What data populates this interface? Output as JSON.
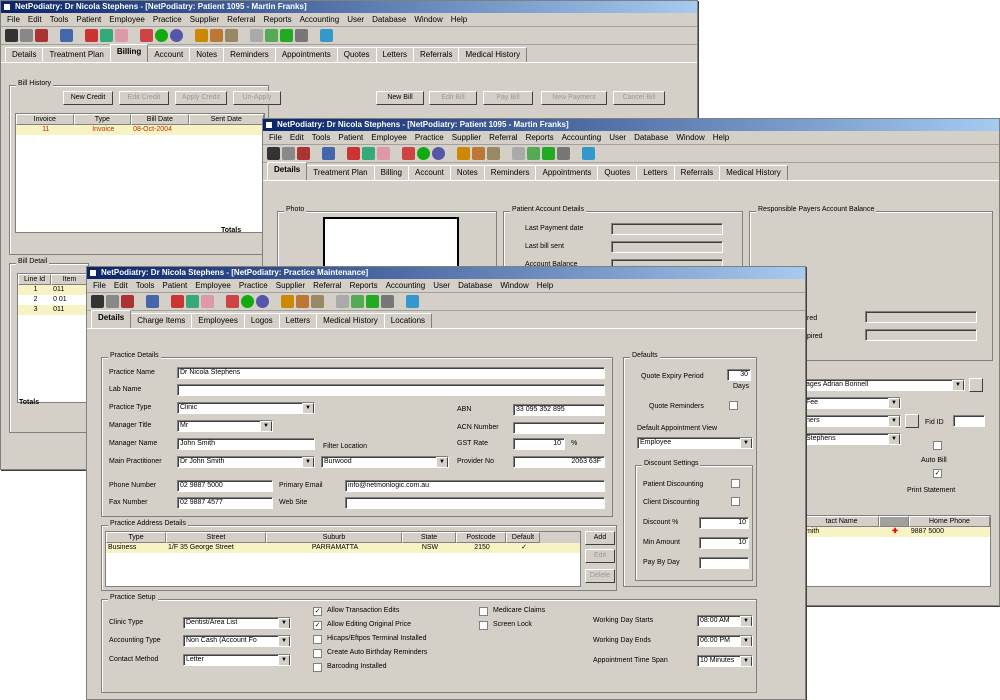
{
  "menu": [
    "File",
    "Edit",
    "Tools",
    "Patient",
    "Employee",
    "Practice",
    "Supplier",
    "Referral",
    "Reports",
    "Accounting",
    "User",
    "Database",
    "Window",
    "Help"
  ],
  "back": {
    "title": "NetPodiatry: Dr Nicola Stephens - [NetPodiatry: Patient 1095 - Martin Franks]",
    "tabs": [
      "Details",
      "Treatment Plan",
      "Billing",
      "Account",
      "Notes",
      "Reminders",
      "Appointments",
      "Quotes",
      "Letters",
      "Referrals",
      "Medical History"
    ],
    "bill_history_label": "Bill History",
    "buttons": [
      "New Credit",
      "Edit Credit",
      "Apply Credit",
      "Un-Apply",
      "New Bill",
      "Edit Bill",
      "Pay Bill",
      "New Payment",
      "Cancel Bill"
    ],
    "columns": [
      "Invoice",
      "Type",
      "Bill Date",
      "Sent Date"
    ],
    "row": [
      "11",
      "Invoice",
      "08-Oct-2004",
      ""
    ],
    "totals_label": "Totals",
    "bill_detail_label": "Bill Detail",
    "detail_columns": [
      "Line Id",
      "Item"
    ],
    "detail_rows": [
      [
        "1",
        "011"
      ],
      [
        "2",
        "0 01"
      ],
      [
        "3",
        "011"
      ]
    ],
    "detail_totals": "Totals"
  },
  "mid": {
    "title": "NetPodiatry: Dr Nicola Stephens - [NetPodiatry: Patient 1095 - Martin Franks]",
    "tabs": [
      "Details",
      "Treatment Plan",
      "Billing",
      "Account",
      "Notes",
      "Reminders",
      "Appointments",
      "Quotes",
      "Letters",
      "Referrals",
      "Medical History"
    ],
    "photo_label": "Photo",
    "pad_label": "Patient Account Details",
    "last_payment": "Last Payment date",
    "last_bill": "Last bill sent",
    "account_balance": "Account Balance",
    "rp_label": "Responsible Payers Account Balance",
    "lbl_red": "red",
    "lbl_pired": "pired",
    "dd1": "ages Adrian Bonnell",
    "dd2": "Fee",
    "dd3": "ners",
    "dd4": "Stephens",
    "fid_label": "Fid ID",
    "auto_bill": "Auto Bill",
    "print_statement": "Print Statement",
    "grid_cols": [
      "tact Name",
      "",
      "Home Phone"
    ],
    "grid_row": [
      "mith",
      "",
      "9887 5000"
    ]
  },
  "front": {
    "title": "NetPodiatry: Dr Nicola Stephens - [NetPodiatry: Practice Maintenance]",
    "tabs": [
      "Details",
      "Charge Items",
      "Employees",
      "Logos",
      "Letters",
      "Medical History",
      "Locations"
    ],
    "practice_details": "Practice Details",
    "practice_name_l": "Practice Name",
    "practice_name": "Dr Nicola Stephens",
    "lab_name_l": "Lab Name",
    "practice_type_l": "Practice Type",
    "practice_type": "Clinic",
    "manager_title_l": "Manager Title",
    "manager_title": "Mr",
    "manager_name_l": "Manager Name",
    "manager_name": "John Smith",
    "main_practitioner_l": "Main Practitioner",
    "main_practitioner": "Dr John Smith",
    "filter_location_l": "Filter Location",
    "filter_location": "Burwood",
    "abn_l": "ABN",
    "abn": "33 095 352 895",
    "acn_l": "ACN Number",
    "gst_l": "GST Rate",
    "gst": "10",
    "gst_unit": "%",
    "provider_l": "Provider No",
    "provider": "2063 63F",
    "phone_l": "Phone Number",
    "phone": "02 9887 5000",
    "fax_l": "Fax Number",
    "fax": "02 9887 4577",
    "email_l": "Primary Email",
    "email": "info@netmonlogic.com.au",
    "web_l": "Web Site",
    "defaults": "Defaults",
    "quote_expiry_l": "Quote Expiry Period",
    "quote_expiry": "30",
    "days": "Days",
    "quote_reminders_l": "Quote Reminders",
    "default_view_l": "Default Appointment View",
    "default_view": "Employee",
    "discount_settings": "Discount Settings",
    "patient_disc": "Patient Discounting",
    "client_disc": "Client Discounting",
    "discount_pct_l": "Discount %",
    "discount_pct": "10",
    "min_amount_l": "Min Amount",
    "min_amount": "10",
    "pay_by_day_l": "Pay By Day",
    "address_details": "Practice Address Details",
    "addr_cols": [
      "Type",
      "Street",
      "Suburb",
      "State",
      "Postcode",
      "Default"
    ],
    "addr_row": [
      "Business",
      "1/F 35 George Street",
      "PARRAMATTA",
      "NSW",
      "2150",
      "✓"
    ],
    "add_btn": "Add",
    "edit_btn": "Edit",
    "delete_btn": "Delete",
    "setup": "Practice Setup",
    "clinic_type_l": "Clinic Type",
    "clinic_type": "Dentist/Area List",
    "acct_type_l": "Accounting Type",
    "acct_type": "Non Cash (Account Fo",
    "contact_l": "Contact Method",
    "contact": "Letter",
    "opts": [
      "Allow Transaction Edits",
      "Allow Editing Original Price",
      "Hicaps/Eftpos Terminal Installed",
      "Create Auto Birthday Reminders",
      "Barcoding Installed"
    ],
    "opts_checked": [
      true,
      true,
      false,
      false,
      false
    ],
    "opts2": [
      "Medicare Claims",
      "Screen Lock"
    ],
    "wd_start_l": "Working Day Starts",
    "wd_start": "08:00 AM",
    "wd_end_l": "Working Day Ends",
    "wd_end": "06:00 PM",
    "slot_l": "Appointment Time Span",
    "slot": "10 Minutes"
  }
}
